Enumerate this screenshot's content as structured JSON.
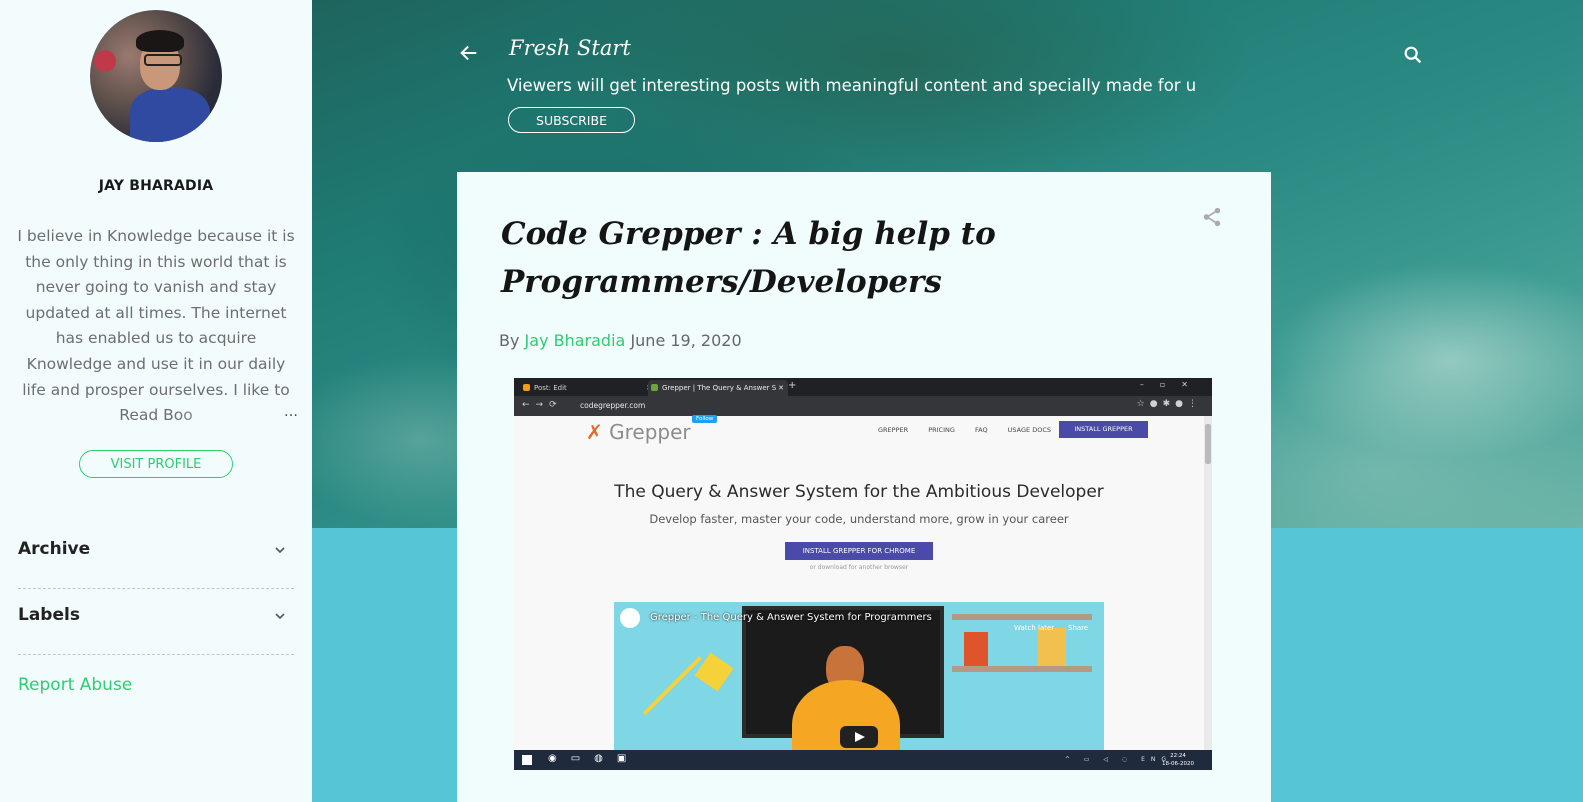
{
  "sidebar": {
    "profile_name": "JAY BHARADIA",
    "about": "I believe in Knowledge because it is the only thing in this world that is never going to vanish and stay updated at all times. The internet has enabled us to acquire Knowledge and use it in our daily life and prosper ourselves. I like to Read Boo",
    "ellipsis": "…",
    "visit_profile": "VISIT PROFILE",
    "widgets": [
      "Archive",
      "Labels"
    ],
    "report_abuse": "Report Abuse"
  },
  "header": {
    "title": "Fresh Start",
    "description": "Viewers will get interesting posts with meaningful content and specially made for u",
    "subscribe": "SUBSCRIBE"
  },
  "post": {
    "title": "Code Grepper : A big help to Programmers/Developers",
    "by": "By",
    "author": "Jay Bharadia",
    "date": "June 19, 2020"
  },
  "screenshot": {
    "tab1": "Post: Edit",
    "tab2": "Grepper | The Query & Answer S",
    "url": "codegrepper.com",
    "logo": "Grepper",
    "follow": "Follow",
    "nav": [
      "GREPPER",
      "PRICING",
      "FAQ",
      "USAGE DOCS"
    ],
    "install": "INSTALL GREPPER",
    "headline": "The Query & Answer System for the Ambitious Developer",
    "subheadline": "Develop faster, master your code, understand more, grow in your career",
    "cta": "INSTALL GREPPER FOR CHROME",
    "cta_sub": "or download for another browser",
    "video_title": "Grepper - The Query & Answer System for Programmers",
    "watch_later": "Watch later",
    "share": "Share",
    "tray": "ENG",
    "time": "22:24",
    "date": "18-06-2020"
  },
  "colors": {
    "accent_green": "#2ecc71",
    "sidebar_bg": "#f2fcfd",
    "lower_bg": "#56c5d6"
  },
  "icons": [
    "back-arrow-icon",
    "search-icon",
    "share-icon",
    "chevron-down-icon"
  ]
}
